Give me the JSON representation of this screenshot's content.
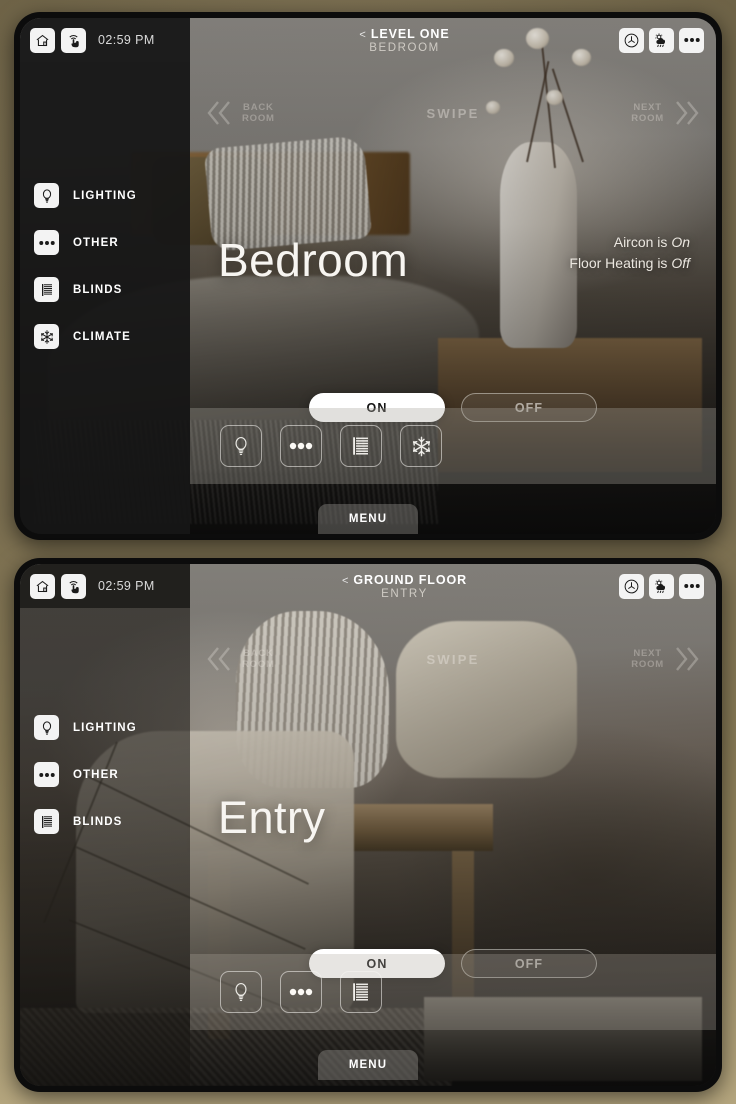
{
  "theme": {
    "page_background": "#766a4e",
    "bezel": "#0c0c0c",
    "accent_white": "#ffffff",
    "sidebar_dark": "#161616",
    "dock_overlay": "rgba(168,164,156,0.34)"
  },
  "panels": [
    {
      "id": "panel-bedroom",
      "statusbar": {
        "home_icon": "home-icon",
        "touch_icon": "touch-gesture-icon",
        "time": "02:59 PM",
        "back_chevron": "<",
        "floor": "LEVEL ONE",
        "room": "BEDROOM",
        "right_icons": [
          {
            "name": "clock-icon",
            "label": "Clock"
          },
          {
            "name": "weather-icon",
            "label": "Weather"
          },
          {
            "name": "more-options-icon",
            "label": "More"
          }
        ]
      },
      "swipe": {
        "back_line1": "BACK",
        "back_line2": "ROOM",
        "center": "SWIPE",
        "next_line1": "NEXT",
        "next_line2": "ROOM"
      },
      "sidebar": [
        {
          "icon": "lightbulb-icon",
          "label": "LIGHTING"
        },
        {
          "icon": "more-dots-icon",
          "label": "OTHER"
        },
        {
          "icon": "blinds-icon",
          "label": "BLINDS"
        },
        {
          "icon": "snowflake-icon",
          "label": "CLIMATE"
        }
      ],
      "main": {
        "room_title": "Bedroom",
        "status_lines": [
          {
            "prefix": "Aircon is ",
            "state": "On"
          },
          {
            "prefix": "Floor Heating is ",
            "state": "Off"
          }
        ],
        "toggle_on": "ON",
        "toggle_off": "OFF",
        "active_toggle": "ON"
      },
      "dock": [
        {
          "icon": "lightbulb-icon",
          "active": false
        },
        {
          "icon": "more-dots-icon",
          "active": false
        },
        {
          "icon": "blinds-icon",
          "active": true
        },
        {
          "icon": "snowflake-icon",
          "active": false
        }
      ],
      "menu_label": "MENU"
    },
    {
      "id": "panel-entry",
      "statusbar": {
        "home_icon": "home-icon",
        "touch_icon": "touch-gesture-icon",
        "time": "02:59 PM",
        "back_chevron": "<",
        "floor": "GROUND FLOOR",
        "room": "ENTRY",
        "right_icons": [
          {
            "name": "clock-icon",
            "label": "Clock"
          },
          {
            "name": "weather-icon",
            "label": "Weather"
          },
          {
            "name": "more-options-icon",
            "label": "More"
          }
        ]
      },
      "swipe": {
        "back_line1": "BACK",
        "back_line2": "ROOM",
        "center": "SWIPE",
        "next_line1": "NEXT",
        "next_line2": "ROOM"
      },
      "sidebar": [
        {
          "icon": "lightbulb-icon",
          "label": "LIGHTING"
        },
        {
          "icon": "more-dots-icon",
          "label": "OTHER"
        },
        {
          "icon": "blinds-icon",
          "label": "BLINDS"
        }
      ],
      "main": {
        "room_title": "Entry",
        "status_lines": [],
        "toggle_on": "ON",
        "toggle_off": "OFF",
        "active_toggle": "ON"
      },
      "dock": [
        {
          "icon": "lightbulb-icon",
          "active": false
        },
        {
          "icon": "more-dots-icon",
          "active": false
        },
        {
          "icon": "blinds-icon",
          "active": true
        }
      ],
      "menu_label": "MENU"
    }
  ]
}
